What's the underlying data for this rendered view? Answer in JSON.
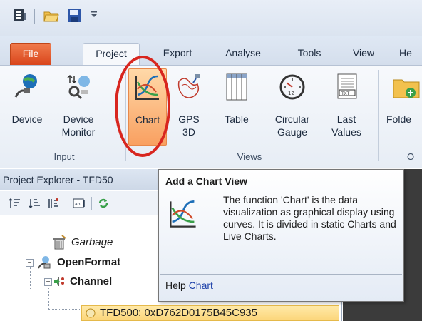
{
  "ribbon_tabs": [
    "File",
    "Project",
    "Export",
    "Analyse",
    "Tools",
    "View",
    "He"
  ],
  "ribbon": {
    "device": "Device",
    "device_monitor": "Device\nMonitor",
    "chart": "Chart",
    "gps3d": "GPS\n3D",
    "table": "Table",
    "circular_gauge": "Circular\nGauge",
    "last_values": "Last\nValues",
    "folder": "Folde",
    "group_input": "Input",
    "group_views": "Views",
    "group_partial": "O"
  },
  "project_explorer": {
    "title": "Project Explorer - TFD50",
    "tree": {
      "garbage": "Garbage",
      "openformat": "OpenFormat",
      "channel": "Channel",
      "device_item": "TFD500: 0xD762D0175B45C935"
    }
  },
  "tooltip": {
    "title": "Add a Chart View",
    "body": "The function 'Chart' is the data visualization as graphical display using curves. It is divided in static Charts and Live Charts.",
    "help_prefix": "Help",
    "help_link": "Chart"
  },
  "colors": {
    "file_tab": "#e2582a",
    "chart_highlight": "#f9a061",
    "annotation_circle": "#d8261f",
    "selected_row": "#fcd67a"
  }
}
